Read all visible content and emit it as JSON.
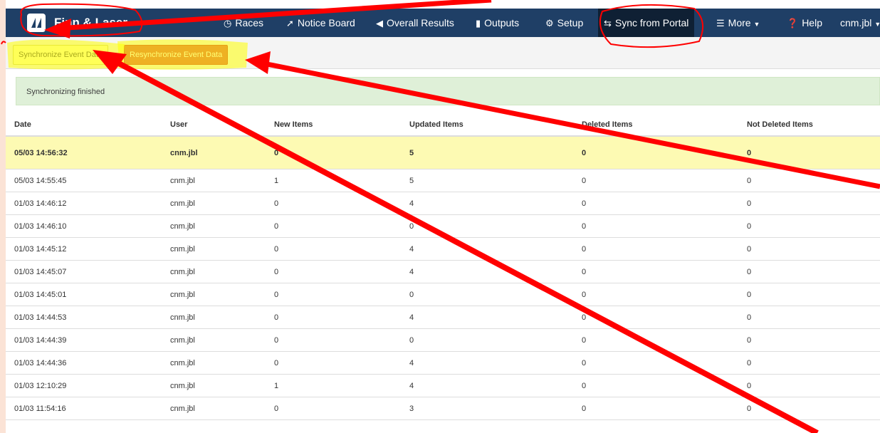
{
  "navbar": {
    "brand": "Finn & Laser",
    "items": [
      {
        "label": "Races",
        "icon": "clock-icon"
      },
      {
        "label": "Notice Board",
        "icon": "pin-icon"
      },
      {
        "label": "Overall Results",
        "icon": "megaphone-icon"
      },
      {
        "label": "Outputs",
        "icon": "file-icon"
      },
      {
        "label": "Setup",
        "icon": "gear-icon"
      },
      {
        "label": "Sync from Portal",
        "icon": "exchange-icon"
      },
      {
        "label": "More",
        "icon": "list-icon"
      },
      {
        "label": "Help",
        "icon": "question-circle-icon"
      },
      {
        "label": "cnm.jbl",
        "icon": "chevron-down-icon"
      }
    ]
  },
  "toolbar": {
    "sync_label": "Synchronize Event Data",
    "resync_label": "Resynchronize Event Data"
  },
  "alert": "Synchronizing finished",
  "table": {
    "headers": [
      "Date",
      "User",
      "New Items",
      "Updated Items",
      "Deleted Items",
      "Not Deleted Items"
    ],
    "rows": [
      [
        "05/03 14:56:32",
        "cnm.jbl",
        "0",
        "5",
        "0",
        "0"
      ],
      [
        "05/03 14:55:45",
        "cnm.jbl",
        "1",
        "5",
        "0",
        "0"
      ],
      [
        "01/03 14:46:12",
        "cnm.jbl",
        "0",
        "4",
        "0",
        "0"
      ],
      [
        "01/03 14:46:10",
        "cnm.jbl",
        "0",
        "0",
        "0",
        "0"
      ],
      [
        "01/03 14:45:12",
        "cnm.jbl",
        "0",
        "4",
        "0",
        "0"
      ],
      [
        "01/03 14:45:07",
        "cnm.jbl",
        "0",
        "4",
        "0",
        "0"
      ],
      [
        "01/03 14:45:01",
        "cnm.jbl",
        "0",
        "0",
        "0",
        "0"
      ],
      [
        "01/03 14:44:53",
        "cnm.jbl",
        "0",
        "4",
        "0",
        "0"
      ],
      [
        "01/03 14:44:39",
        "cnm.jbl",
        "0",
        "0",
        "0",
        "0"
      ],
      [
        "01/03 14:44:36",
        "cnm.jbl",
        "0",
        "4",
        "0",
        "0"
      ],
      [
        "01/03 12:10:29",
        "cnm.jbl",
        "1",
        "4",
        "0",
        "0"
      ],
      [
        "01/03 11:54:16",
        "cnm.jbl",
        "0",
        "3",
        "0",
        "0"
      ]
    ]
  },
  "colors": {
    "navbar": "#1f3f66",
    "highlight_row": "#fdfab3",
    "alert_bg": "#dff0d8",
    "resync_button": "#d9534f",
    "annotation_red": "#ff0000",
    "annotation_yellow": "#ffff00"
  }
}
